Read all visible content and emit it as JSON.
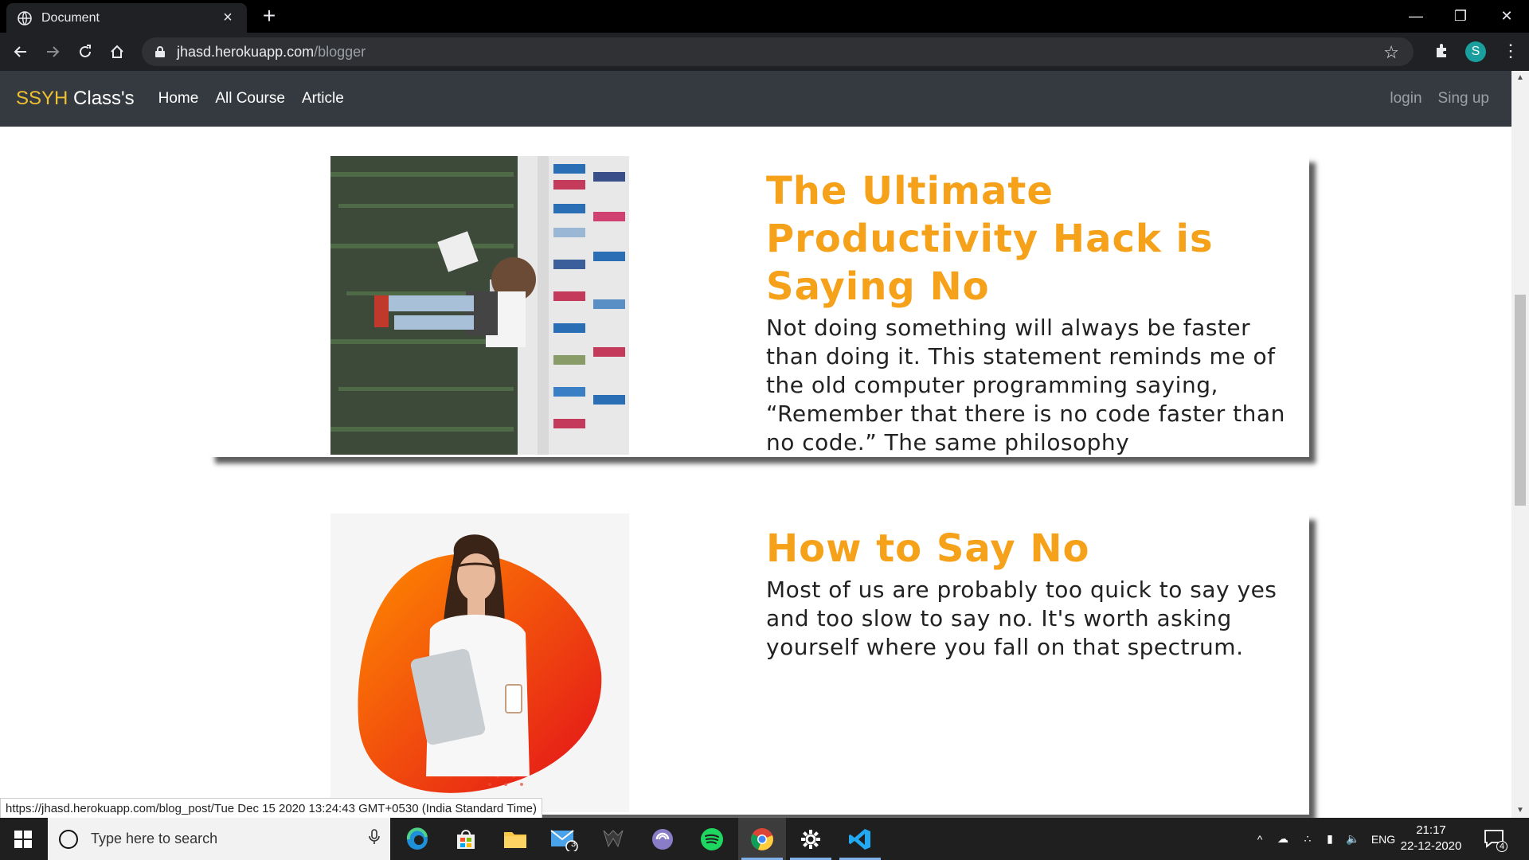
{
  "browser": {
    "tab_title": "Document",
    "url_domain": "jhasd.herokuapp.com",
    "url_path": "/blogger",
    "profile_initial": "S"
  },
  "site": {
    "brand_accent": "SSYH",
    "brand_rest": " Class's",
    "nav": [
      "Home",
      "All Course",
      "Article"
    ],
    "auth": [
      "login",
      "Sing up"
    ]
  },
  "posts": [
    {
      "title": "The Ultimate Productivity Hack is Saying No",
      "excerpt": "Not doing something will always be faster than doing it. This statement reminds me of the old computer programming saying, “Remember that there is no code faster than no code.” The same philosophy"
    },
    {
      "title": "How to Say No",
      "excerpt": "Most of us are probably too quick to say yes and too slow to say no. It's worth asking yourself where you fall on that spectrum."
    }
  ],
  "status_url": "https://jhasd.herokuapp.com/blog_post/Tue Dec 15 2020 13:24:43 GMT+0530 (India Standard Time)",
  "taskbar": {
    "search_placeholder": "Type here to search",
    "mail_badge": "3",
    "lang": "ENG",
    "time": "21:17",
    "date": "22-12-2020",
    "notification_count": "4"
  },
  "colors": {
    "accent_orange": "#f5a11a",
    "navbar_bg": "#343a40",
    "brand_yellow": "#f0c12f"
  }
}
